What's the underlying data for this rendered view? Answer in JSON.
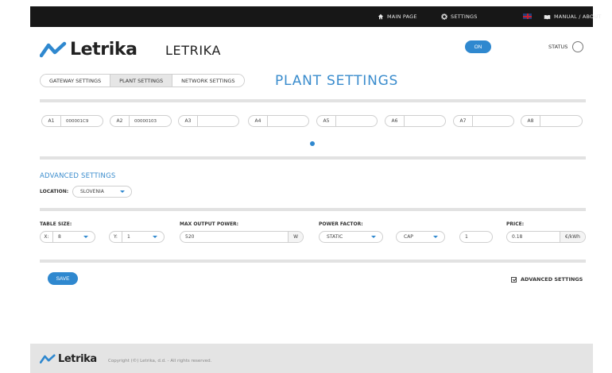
{
  "topbar": {
    "nav": [
      {
        "label": "MAIN PAGE",
        "icon": "home-icon"
      },
      {
        "label": "SETTINGS",
        "icon": "gear-icon"
      },
      {
        "label": "",
        "icon": "uk-flag-icon"
      },
      {
        "label": "MANUAL / ABOUT",
        "icon": "book-icon"
      }
    ]
  },
  "header": {
    "logo_text": "Letrika",
    "brand_title": "LETRIKA",
    "power_button": "ON",
    "status_label": "STATUS"
  },
  "tabs": [
    {
      "label": "GATEWAY SETTINGS",
      "active": false
    },
    {
      "label": "PLANT SETTINGS",
      "active": true
    },
    {
      "label": "NETWORK SETTINGS",
      "active": false
    }
  ],
  "page_title": "PLANT SETTINGS",
  "slots": [
    {
      "label": "A1",
      "value": "000001C9"
    },
    {
      "label": "A2",
      "value": "00000103"
    },
    {
      "label": "A3",
      "value": ""
    },
    {
      "label": "A4",
      "value": ""
    },
    {
      "label": "A5",
      "value": ""
    },
    {
      "label": "A6",
      "value": ""
    },
    {
      "label": "A7",
      "value": ""
    },
    {
      "label": "A8",
      "value": ""
    }
  ],
  "advanced": {
    "title": "ADVANCED SETTINGS",
    "location_label": "LOCATION:",
    "location_value": "SLOVENIA"
  },
  "plant": {
    "table_size_label": "TABLE SIZE:",
    "x_label": "X:",
    "x_value": "8",
    "y_label": "Y:",
    "y_value": "1",
    "max_output_label": "MAX OUTPUT POWER:",
    "max_output_value": "520",
    "max_output_unit": "W",
    "power_factor_label": "POWER FACTOR:",
    "power_factor_mode": "STATIC",
    "power_factor_type": "CAP",
    "power_factor_value": "1",
    "price_label": "PRICE:",
    "price_value": "0.18",
    "price_unit": "€/kWh"
  },
  "actions": {
    "save_label": "SAVE",
    "advanced_checkbox_label": "ADVANCED SETTINGS",
    "advanced_checked": true
  },
  "footer": {
    "logo_text": "Letrika",
    "copyright": "Copyright (©) Letrika, d.d. - All rights reserved."
  },
  "colors": {
    "accent": "#2f88cf",
    "topbar": "#171717",
    "footer": "#e4e4e4"
  }
}
